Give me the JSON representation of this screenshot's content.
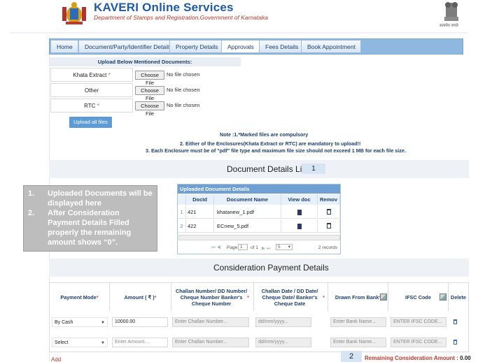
{
  "header": {
    "title": "KAVERI Online Services",
    "subtitle": "Department of Stamps and Registration,Government of Karnataka",
    "emblem_caption": "सत्यमेव जयते"
  },
  "tabs": [
    {
      "label": "Home"
    },
    {
      "label": "Document/Party/Identifier Details"
    },
    {
      "label": "Property Details"
    },
    {
      "label": "Approvals",
      "active": true
    },
    {
      "label": "Fees Details"
    },
    {
      "label": "Book Appointment"
    }
  ],
  "upload": {
    "header": "Upload Below Mentioned Documents:",
    "rows": [
      {
        "label": "Khata Extract",
        "required": true,
        "button": "Choose File",
        "status": "No file chosen"
      },
      {
        "label": "Other",
        "required": false,
        "button": "Choose File",
        "status": "No file chosen"
      },
      {
        "label": "RTC",
        "required": true,
        "button": "Choose File",
        "status": "No file chosen"
      }
    ],
    "upload_all": "Upload all files",
    "notes": [
      "Note :1.*Marked files are compulsory",
      "2. Either of the Enclosures(Khata Extract or RTC) are mandatory to upload!!",
      "3. Each Enclosure must be of \"pdf\" file type and maximum file size should not exceed 1 MB for each file size."
    ]
  },
  "document_list": {
    "title": "Document Details List",
    "count": "1"
  },
  "callout": {
    "items": [
      {
        "num": "1.",
        "text": "Uploaded Documents will be displayed here"
      },
      {
        "num": "2.",
        "text": "After Consideration Payment Details Filled properly the remaining amount shows “0”."
      }
    ]
  },
  "uploaded_grid": {
    "caption": "Uploaded Document Details",
    "columns": [
      "DocId",
      "Document Name",
      "View doc",
      "Remov"
    ],
    "rows": [
      {
        "num": "1",
        "docid": "421",
        "name": "khatanew_1.pdf"
      },
      {
        "num": "2",
        "docid": "422",
        "name": "ECnew_5.pdf"
      }
    ],
    "pager": {
      "page_label": "Page",
      "page": "1",
      "of": "of 1",
      "size": "5",
      "records": "2 records"
    }
  },
  "consideration": {
    "title": "Consideration Payment Details",
    "columns": [
      {
        "label": "Payment Mode",
        "required": true
      },
      {
        "label": "Amount ( ₹ )",
        "required": true
      },
      {
        "label": "Challan Number/ DD Number/ Cheque Number Banker's Cheque Number",
        "required": true
      },
      {
        "label": "Challan Date / DD Date/ Cheque Date/ Banker's Cheque Date",
        "required": true
      },
      {
        "label": "Drawn From Bank",
        "required": true
      },
      {
        "label": "IFSC Code",
        "required": false
      },
      {
        "label": "Delete",
        "required": false
      }
    ],
    "rows": [
      {
        "mode": "By Cash",
        "amount": "10000.00",
        "challan": "Enter Challan Number...",
        "date": "dd/mm/yyyy...",
        "bank": "Enter Bank Name...",
        "ifsc": "ENTER IFSC CODE..."
      },
      {
        "mode": "Select",
        "amount": "Enter Amount...",
        "challan": "Enter Challan Number...",
        "date": "dd/mm/yyyy...",
        "bank": "Enter Bank Name...",
        "ifsc": "ENTER IFSC CODE..."
      }
    ],
    "add_label": "Add",
    "remaining_label": "Remaining Consideration Amount :",
    "remaining_value": "0.00"
  },
  "page_number": "2",
  "colors": {
    "brand_blue": "#1f5aa6",
    "accent_red": "#c0392b",
    "tab_blue": "#8fb8df"
  }
}
